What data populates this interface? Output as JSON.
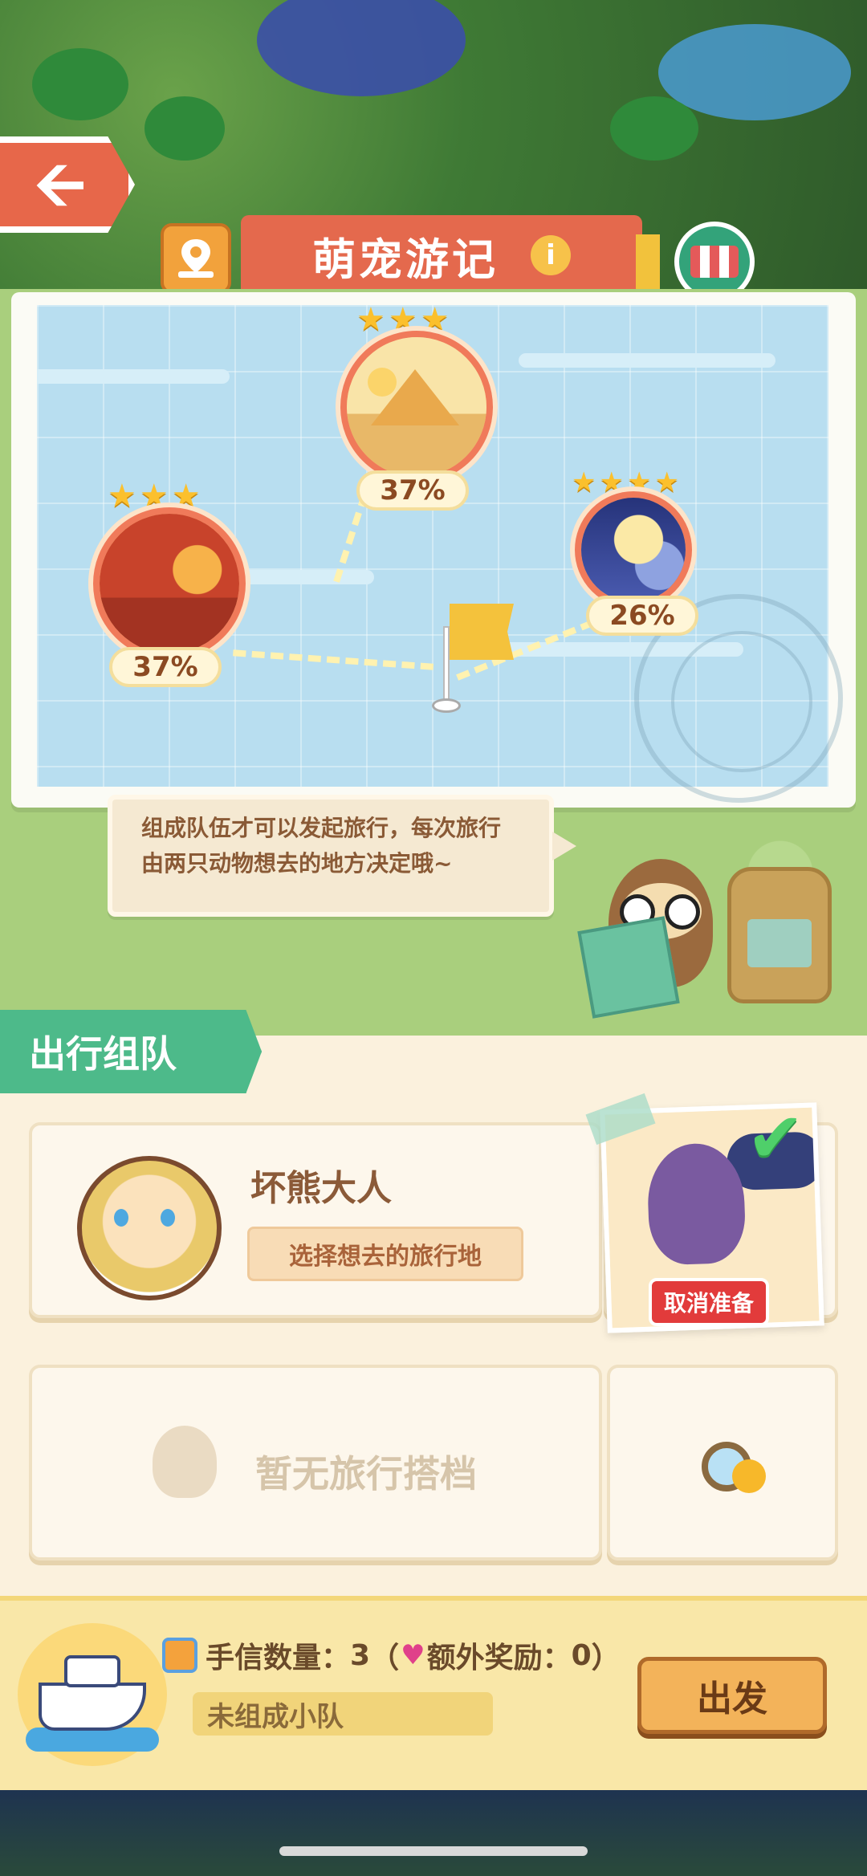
{
  "header": {
    "title": "萌宠游记",
    "info_icon": "i"
  },
  "destinations": [
    {
      "name": "desert",
      "percent": "37%",
      "stars": 3
    },
    {
      "name": "sunset-town",
      "percent": "37%",
      "stars": 3
    },
    {
      "name": "night-sky",
      "percent": "26%",
      "stars": 4
    }
  ],
  "guide": {
    "text": "组成队伍才可以发起旅行，每次旅行由两只动物想去的地方决定哦~"
  },
  "team": {
    "tab_label": "出行组队",
    "player": {
      "name": "坏熊大人",
      "choose_label": "选择想去的旅行地"
    },
    "partner": {
      "cancel_label": "取消准备"
    },
    "empty_slot": {
      "label": "暂无旅行搭档"
    }
  },
  "footer": {
    "letters_label": "手信数量：",
    "letters_count": "3",
    "bonus_open": "（",
    "bonus_label": "额外奖励：",
    "bonus_value": "0",
    "bonus_close": "）",
    "status": "未组成小队",
    "go_label": "出发"
  },
  "colors": {
    "accent_red": "#e4694d",
    "team_green": "#4dba8a",
    "cancel_red": "#e23b3b",
    "go_orange": "#f3b35a"
  }
}
